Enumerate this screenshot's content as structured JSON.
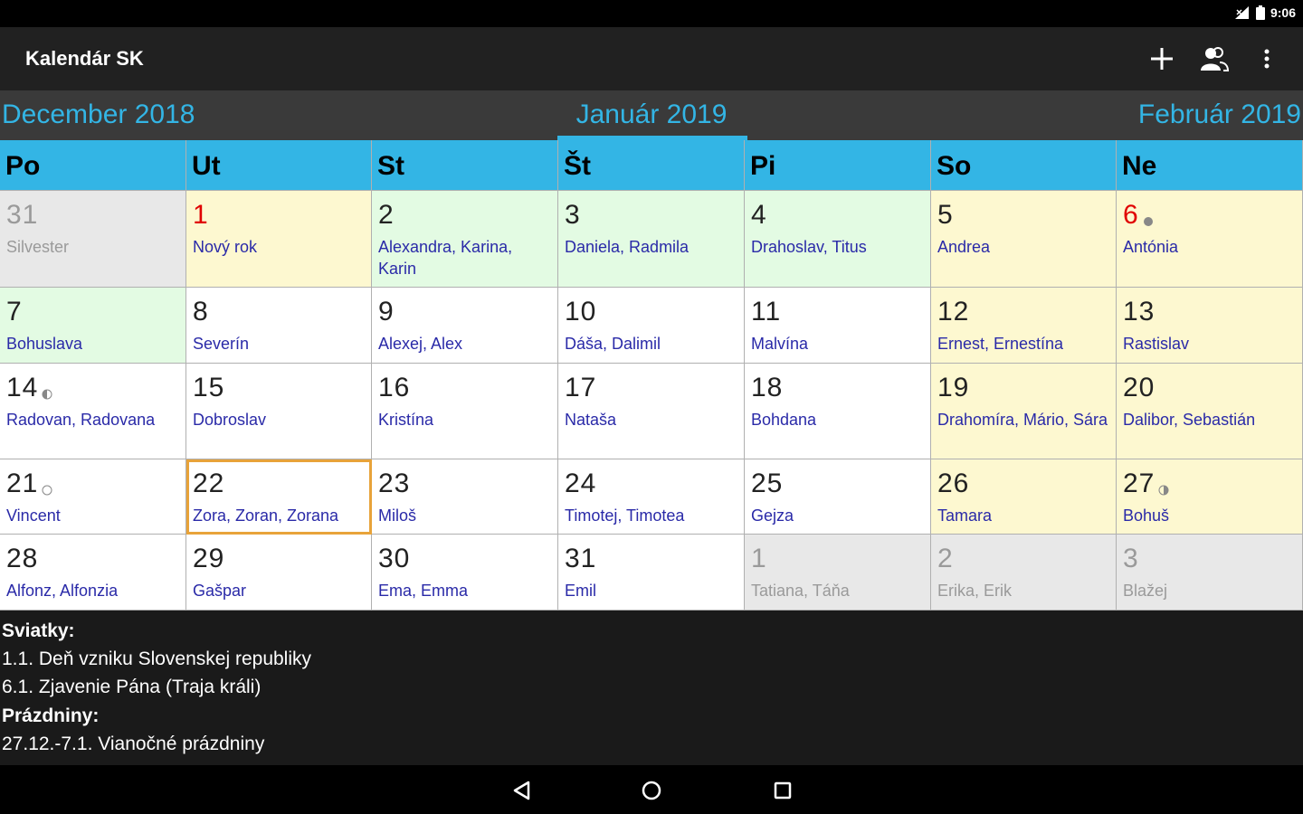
{
  "status": {
    "time": "9:06"
  },
  "app": {
    "title": "Kalendár SK"
  },
  "actions": [
    {
      "name": "add-icon"
    },
    {
      "name": "contacts-icon"
    },
    {
      "name": "more-vert-icon"
    }
  ],
  "months": {
    "prev": "December 2018",
    "current": "Január 2019",
    "next": "Február 2019"
  },
  "colors": {
    "accent": "#33b5e5",
    "weekend": "#fdf8d0",
    "holiday_week": "#e3fbe3",
    "other_month": "#e8e8e8",
    "normal": "#ffffff",
    "today_border": "#e8a33a",
    "name_color": "#2a2aa8",
    "holiday_red": "#e00000"
  },
  "weekdays": [
    "Po",
    "Ut",
    "St",
    "Št",
    "Pi",
    "So",
    "Ne"
  ],
  "weeks": [
    [
      {
        "day": "31",
        "names": "Silvester",
        "bg": "other",
        "style": "grey"
      },
      {
        "day": "1",
        "names": "Nový rok",
        "bg": "weekend",
        "style": "red"
      },
      {
        "day": "2",
        "names": "Alexandra, Karina, Karin",
        "bg": "green"
      },
      {
        "day": "3",
        "names": "Daniela, Radmila",
        "bg": "green"
      },
      {
        "day": "4",
        "names": "Drahoslav, Titus",
        "bg": "green"
      },
      {
        "day": "5",
        "names": "Andrea",
        "bg": "weekend"
      },
      {
        "day": "6",
        "names": "Antónia",
        "bg": "weekend",
        "style": "red",
        "moon": "full-dot"
      }
    ],
    [
      {
        "day": "7",
        "names": "Bohuslava",
        "bg": "green"
      },
      {
        "day": "8",
        "names": "Severín",
        "bg": "normal"
      },
      {
        "day": "9",
        "names": "Alexej, Alex",
        "bg": "normal"
      },
      {
        "day": "10",
        "names": "Dáša, Dalimil",
        "bg": "normal"
      },
      {
        "day": "11",
        "names": "Malvína",
        "bg": "normal"
      },
      {
        "day": "12",
        "names": "Ernest, Ernestína",
        "bg": "weekend"
      },
      {
        "day": "13",
        "names": "Rastislav",
        "bg": "weekend"
      }
    ],
    [
      {
        "day": "14",
        "names": "Radovan, Radovana",
        "bg": "normal",
        "moon": "first-quarter"
      },
      {
        "day": "15",
        "names": "Dobroslav",
        "bg": "normal"
      },
      {
        "day": "16",
        "names": "Kristína",
        "bg": "normal"
      },
      {
        "day": "17",
        "names": "Nataša",
        "bg": "normal"
      },
      {
        "day": "18",
        "names": "Bohdana",
        "bg": "normal"
      },
      {
        "day": "19",
        "names": "Drahomíra, Mário, Sára",
        "bg": "weekend"
      },
      {
        "day": "20",
        "names": "Dalibor, Sebastián",
        "bg": "weekend"
      }
    ],
    [
      {
        "day": "21",
        "names": "Vincent",
        "bg": "normal",
        "moon": "full"
      },
      {
        "day": "22",
        "names": "Zora, Zoran, Zorana",
        "bg": "normal",
        "today": true
      },
      {
        "day": "23",
        "names": "Miloš",
        "bg": "normal"
      },
      {
        "day": "24",
        "names": "Timotej, Timotea",
        "bg": "normal"
      },
      {
        "day": "25",
        "names": "Gejza",
        "bg": "normal"
      },
      {
        "day": "26",
        "names": "Tamara",
        "bg": "weekend"
      },
      {
        "day": "27",
        "names": "Bohuš",
        "bg": "weekend",
        "moon": "last-quarter"
      }
    ],
    [
      {
        "day": "28",
        "names": "Alfonz, Alfonzia",
        "bg": "normal"
      },
      {
        "day": "29",
        "names": "Gašpar",
        "bg": "normal"
      },
      {
        "day": "30",
        "names": "Ema, Emma",
        "bg": "normal"
      },
      {
        "day": "31",
        "names": "Emil",
        "bg": "normal"
      },
      {
        "day": "1",
        "names": "Tatiana, Táňa",
        "bg": "other",
        "style": "grey"
      },
      {
        "day": "2",
        "names": "Erika, Erik",
        "bg": "other",
        "style": "grey"
      },
      {
        "day": "3",
        "names": "Blažej",
        "bg": "other",
        "style": "grey"
      }
    ]
  ],
  "info": {
    "holidays_label": "Sviatky:",
    "holidays": [
      "1.1. Deň vzniku Slovenskej republiky",
      "6.1. Zjavenie Pána (Traja králi)"
    ],
    "vacations_label": "Prázdniny:",
    "vacations": [
      "27.12.-7.1. Vianočné prázdniny"
    ]
  },
  "nav": [
    {
      "name": "back-icon"
    },
    {
      "name": "home-icon"
    },
    {
      "name": "recents-icon"
    }
  ]
}
